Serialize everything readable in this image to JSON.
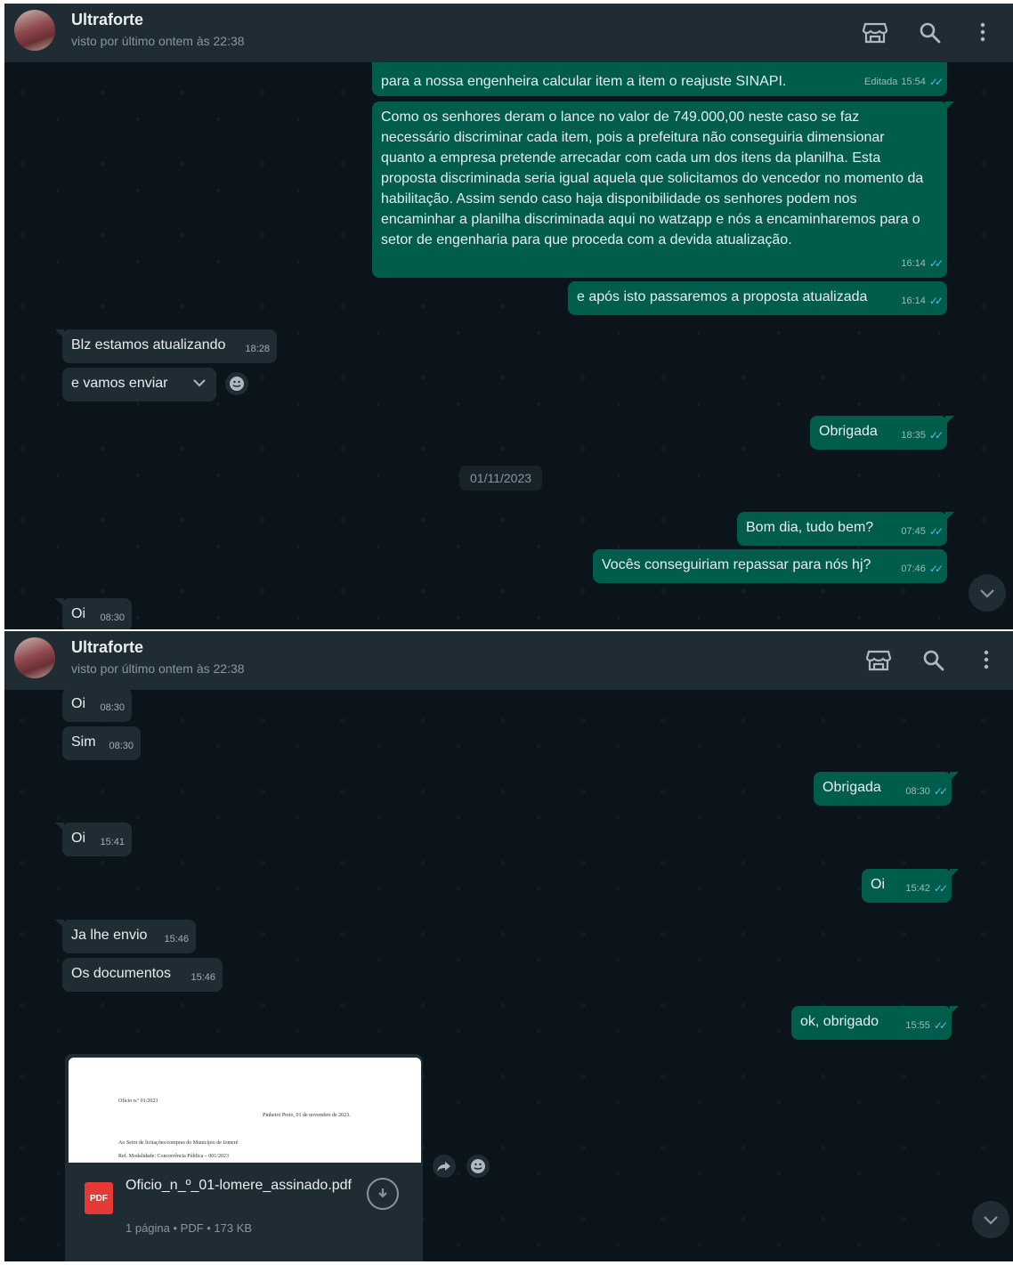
{
  "header": {
    "contact_name": "Ultraforte",
    "last_seen": "visto por último ontem às 22:38"
  },
  "icons": [
    "storefront-icon",
    "search-icon",
    "menu-dots-icon",
    "chevron-down-icon",
    "emoji-icon",
    "forward-icon",
    "download-icon",
    "double-check-icon"
  ],
  "colors": {
    "chat_bg": "#0b141a",
    "header_bg": "#202c33",
    "outgoing": "#005c4b",
    "incoming": "#202c33",
    "read_ticks": "#53bdeb"
  },
  "panel1": {
    "m1": {
      "text": "para a nossa engenheira calcular item a item o reajuste SINAPI.",
      "edited": "Editada",
      "time": "15:54"
    },
    "m2": {
      "text": "Como os senhores deram o lance no valor de 749.000,00 neste caso se faz necessário discriminar cada item, pois a prefeitura não conseguiria dimensionar quanto a empresa pretende arrecadar com cada um dos itens da planilha. Esta proposta discriminada seria igual aquela que solicitamos do vencedor no momento da habilitação. Assim sendo caso haja disponibilidade os senhores podem nos encaminhar a planilha discriminada aqui no watzapp e nós a encaminharemos para o setor de engenharia para que proceda com a devida atualização.",
      "time": "16:14"
    },
    "m3": {
      "text": "e após isto passaremos a proposta atualizada",
      "time": "16:14"
    },
    "m4": {
      "text": "Blz estamos atualizando",
      "time": "18:28"
    },
    "m5": {
      "text": "e vamos enviar"
    },
    "m6": {
      "text": "Obrigada",
      "time": "18:35"
    },
    "date": "01/11/2023",
    "m7": {
      "text": "Bom dia, tudo bem?",
      "time": "07:45"
    },
    "m8": {
      "text": "Vocês conseguiriam repassar para nós hj?",
      "time": "07:46"
    },
    "m9": {
      "text": "Oi",
      "time": "08:30"
    }
  },
  "panel2": {
    "m1": {
      "text": "Oi",
      "time": "08:30"
    },
    "m2": {
      "text": "Sim",
      "time": "08:30"
    },
    "m3": {
      "text": "Obrigada",
      "time": "08:30"
    },
    "m4": {
      "text": "Oi",
      "time": "15:41"
    },
    "m5": {
      "text": "Oi",
      "time": "15:42"
    },
    "m6": {
      "text": "Ja lhe envio",
      "time": "15:46"
    },
    "m7": {
      "text": "Os documentos",
      "time": "15:46"
    },
    "m8": {
      "text": "ok, obrigado",
      "time": "15:55"
    },
    "document": {
      "badge": "PDF",
      "filename": "Oficio_n_º_01-lomere_assinado.pdf",
      "meta": "1 página • PDF • 173 KB",
      "preview_line1": "Ofício n.º 01/2023",
      "preview_line2": "Pinheiro Preto, 01 de novembro de 2023.",
      "preview_line3": "Ao Setor de licitações/compras do Município de Iomeré",
      "preview_line4": "Ref. Modalidade: Concorrência Pública – 001/2023"
    }
  }
}
